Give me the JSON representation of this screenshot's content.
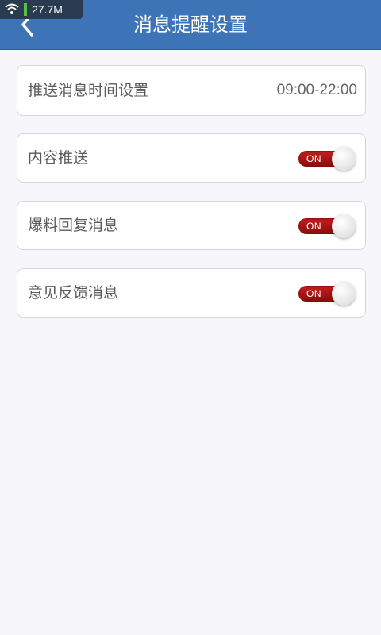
{
  "status_bar": {
    "net_speed": "27.7M",
    "icons": [
      "wifi-icon",
      "signal-bar"
    ]
  },
  "header": {
    "title": "消息提醒设置",
    "back_icon": "chevron-left-icon",
    "color": "#3d74b8"
  },
  "settings": {
    "push_time": {
      "label": "推送消息时间设置",
      "value": "09:00-22:00"
    },
    "items": [
      {
        "label": "内容推送",
        "toggle_text": "ON",
        "on": true
      },
      {
        "label": "爆料回复消息",
        "toggle_text": "ON",
        "on": true
      },
      {
        "label": "意见反馈消息",
        "toggle_text": "ON",
        "on": true
      }
    ]
  },
  "colors": {
    "toggle_on": "#b51414",
    "background": "#f7f6fa"
  }
}
